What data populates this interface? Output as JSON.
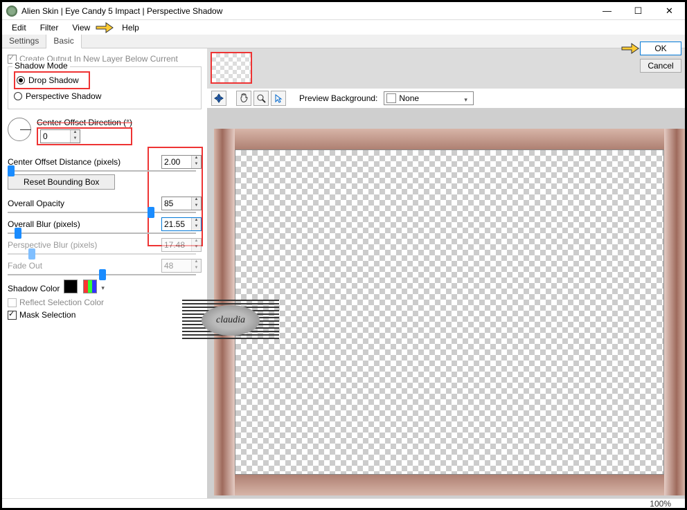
{
  "title": "Alien Skin | Eye Candy 5 Impact | Perspective Shadow",
  "menu": {
    "edit": "Edit",
    "filter": "Filter",
    "view": "View",
    "help": "Help"
  },
  "tabs": {
    "settings": "Settings",
    "basic": "Basic"
  },
  "left": {
    "create_output": "Create Output In New Layer Below Current",
    "shadow_mode_label": "Shadow Mode",
    "drop_shadow": "Drop Shadow",
    "perspective_shadow": "Perspective Shadow",
    "center_offset_direction": "Center Offset Direction (°)",
    "direction_value": "0",
    "center_offset_distance": "Center Offset Distance (pixels)",
    "distance_value": "2.00",
    "reset_bounding_box": "Reset Bounding Box",
    "overall_opacity": "Overall Opacity",
    "opacity_value": "85",
    "overall_blur": "Overall Blur (pixels)",
    "blur_value": "21.55",
    "perspective_blur": "Perspective Blur (pixels)",
    "perspective_blur_value": "17.48",
    "fade_out": "Fade Out",
    "fade_out_value": "48",
    "shadow_color": "Shadow Color",
    "reflect_selection": "Reflect Selection Color",
    "mask_selection": "Mask Selection"
  },
  "toolbar": {
    "preview_bg_label": "Preview Background:",
    "preview_bg_value": "None"
  },
  "buttons": {
    "ok": "OK",
    "cancel": "Cancel"
  },
  "status": {
    "zoom": "100%"
  },
  "watermark": "claudia"
}
